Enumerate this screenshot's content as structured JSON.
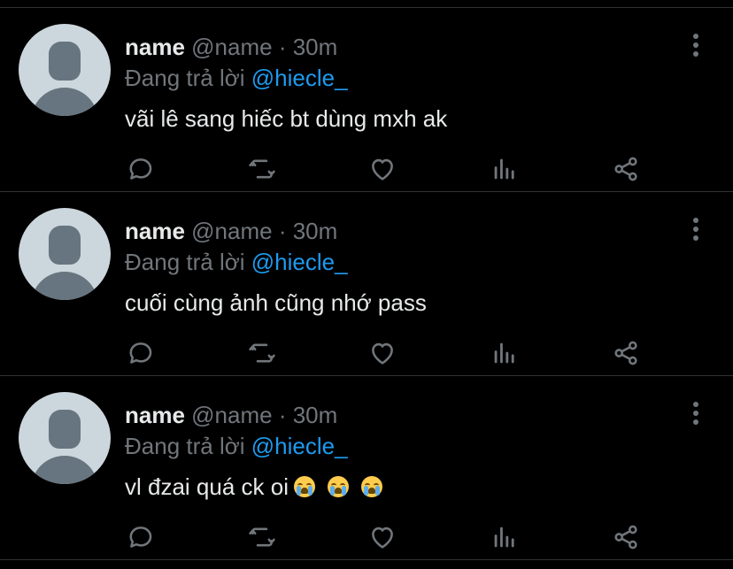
{
  "tweets": [
    {
      "name": "name",
      "handle": "@name",
      "separator": " · ",
      "time": "30m",
      "reply_prefix": "Đang trả lời ",
      "reply_to": "@hiecle_",
      "text": "vãi lê sang hiếc bt dùng mxh ak",
      "emoji_count": 0
    },
    {
      "name": "name",
      "handle": "@name",
      "separator": " · ",
      "time": "30m",
      "reply_prefix": "Đang trả lời ",
      "reply_to": "@hiecle_",
      "text": "cuối cùng ảnh cũng nhớ pass",
      "emoji_count": 0
    },
    {
      "name": "name",
      "handle": "@name",
      "separator": " · ",
      "time": "30m",
      "reply_prefix": "Đang trả lời ",
      "reply_to": "@hiecle_",
      "text": "vl đzai quá ck oi",
      "emoji_count": 3,
      "emoji_icon": "loudly-crying-face"
    }
  ],
  "action_icons": [
    "reply-icon",
    "retweet-icon",
    "like-icon",
    "analytics-icon",
    "share-icon"
  ],
  "colors": {
    "background": "#000000",
    "primary_text": "#e7e9ea",
    "secondary_text": "#71767b",
    "link": "#1d9bf0",
    "divider": "#2f3336"
  }
}
